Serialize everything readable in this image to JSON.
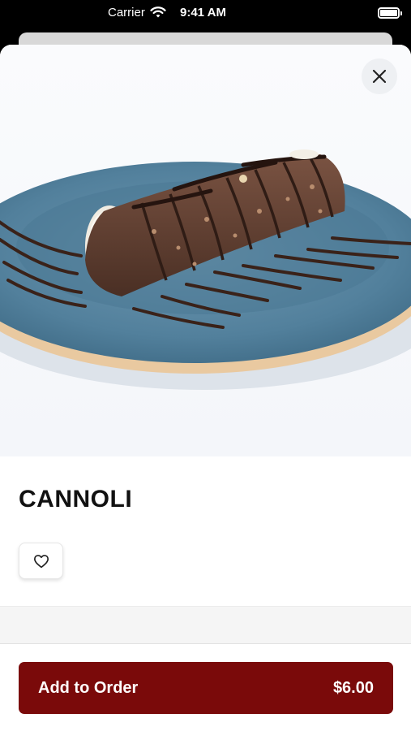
{
  "status_bar": {
    "carrier": "Carrier",
    "time": "9:41 AM",
    "icons": [
      "wifi-icon",
      "battery-icon"
    ]
  },
  "item": {
    "name": "CANNOLI",
    "image_alt": "cannoli-photo",
    "favorite_icon": "heart-outline-icon"
  },
  "close_icon": "close-icon",
  "order_button": {
    "label": "Add to Order",
    "price": "$6.00",
    "color": "#7a0a0a"
  }
}
